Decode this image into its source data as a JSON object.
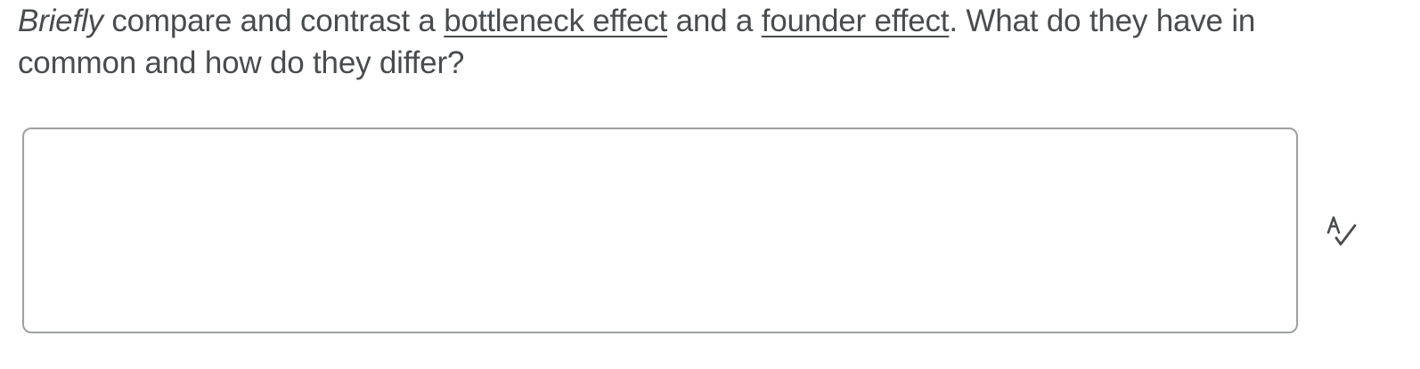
{
  "question": {
    "intro_italic": "Briefly",
    "part1": " compare and contrast a ",
    "term1": "bottleneck effect",
    "part2": " and a ",
    "term2": "founder effect",
    "part3": ".  What do they have in common and how do they differ?"
  },
  "answer": {
    "value": "",
    "placeholder": ""
  },
  "icons": {
    "spellcheck": "spellcheck-icon"
  },
  "colors": {
    "text": "#494c4e",
    "border": "#9ea1a3"
  }
}
